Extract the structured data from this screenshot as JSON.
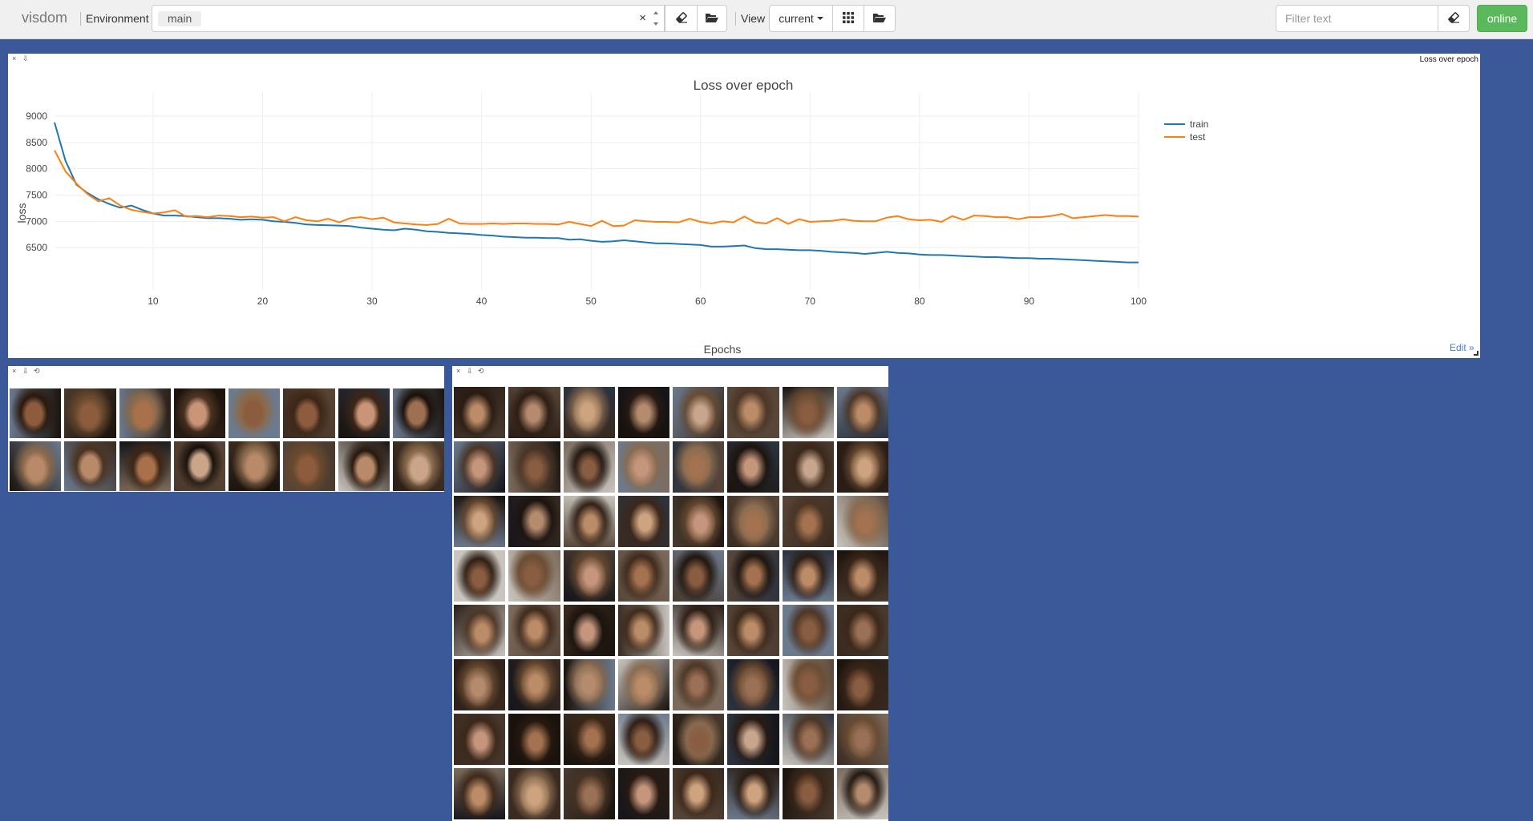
{
  "navbar": {
    "brand": "visdom",
    "environment_label": "Environment",
    "environment_chip": "main",
    "environment_clear": "×",
    "view_label": "View",
    "view_select": "current",
    "filter_placeholder": "Filter text",
    "status_button": "online"
  },
  "colors": {
    "background": "#3b5998",
    "train": "#1f77b4",
    "test": "#ff7f0e",
    "online": "#5cb85c",
    "edit_link": "#447adb"
  },
  "icons": {
    "env_eraser": "eraser-icon",
    "env_folder": "folder-open-icon",
    "view_grid": "grid-icon",
    "view_folder": "folder-open-icon",
    "filter_eraser": "eraser-icon",
    "pane_close": "×",
    "pane_download": "⇩",
    "pane_reset": "⟲"
  },
  "loss_pane": {
    "title": "Loss over epoch",
    "edit_link": "Edit »"
  },
  "chart_data": {
    "type": "line",
    "title": "Loss over epoch",
    "xlabel": "Epochs",
    "ylabel": "loss",
    "xlim": [
      1,
      100
    ],
    "ylim": [
      6000,
      9000
    ],
    "x_ticks": [
      10,
      20,
      30,
      40,
      50,
      60,
      70,
      80,
      90,
      100
    ],
    "y_ticks": [
      6500,
      7000,
      7500,
      8000,
      8500,
      9000
    ],
    "grid": true,
    "legend_position": "top-right",
    "x": [
      1,
      2,
      3,
      4,
      5,
      6,
      7,
      8,
      9,
      10,
      11,
      12,
      13,
      14,
      15,
      16,
      17,
      18,
      19,
      20,
      21,
      22,
      23,
      24,
      25,
      26,
      27,
      28,
      29,
      30,
      31,
      32,
      33,
      34,
      35,
      36,
      37,
      38,
      39,
      40,
      41,
      42,
      43,
      44,
      45,
      46,
      47,
      48,
      49,
      50,
      51,
      52,
      53,
      54,
      55,
      56,
      57,
      58,
      59,
      60,
      61,
      62,
      63,
      64,
      65,
      66,
      67,
      68,
      69,
      70,
      71,
      72,
      73,
      74,
      75,
      76,
      77,
      78,
      79,
      80,
      81,
      82,
      83,
      84,
      85,
      86,
      87,
      88,
      89,
      90,
      91,
      92,
      93,
      94,
      95,
      96,
      97,
      98,
      99,
      100
    ],
    "series": [
      {
        "name": "train",
        "values": [
          8880,
          8150,
          7700,
          7540,
          7420,
          7330,
          7260,
          7300,
          7220,
          7150,
          7110,
          7110,
          7100,
          7080,
          7060,
          7060,
          7050,
          7030,
          7040,
          7030,
          7000,
          6990,
          6970,
          6940,
          6930,
          6925,
          6920,
          6910,
          6880,
          6860,
          6840,
          6830,
          6860,
          6840,
          6810,
          6800,
          6780,
          6770,
          6760,
          6740,
          6730,
          6710,
          6700,
          6690,
          6690,
          6680,
          6680,
          6650,
          6660,
          6630,
          6610,
          6620,
          6640,
          6620,
          6600,
          6580,
          6580,
          6570,
          6560,
          6550,
          6520,
          6520,
          6530,
          6540,
          6490,
          6470,
          6470,
          6460,
          6450,
          6450,
          6440,
          6420,
          6410,
          6400,
          6380,
          6400,
          6420,
          6400,
          6390,
          6370,
          6360,
          6360,
          6350,
          6340,
          6330,
          6320,
          6320,
          6310,
          6300,
          6300,
          6290,
          6290,
          6280,
          6270,
          6260,
          6250,
          6240,
          6230,
          6220,
          6220
        ]
      },
      {
        "name": "test",
        "values": [
          8350,
          7950,
          7720,
          7520,
          7380,
          7440,
          7300,
          7220,
          7180,
          7150,
          7170,
          7210,
          7090,
          7100,
          7080,
          7110,
          7100,
          7080,
          7090,
          7070,
          7080,
          7000,
          7080,
          7020,
          7000,
          7050,
          6980,
          7060,
          7080,
          7040,
          7070,
          6980,
          6960,
          6940,
          6930,
          6950,
          7050,
          6960,
          6950,
          6950,
          6960,
          6950,
          6960,
          6960,
          6950,
          6950,
          6940,
          6990,
          6950,
          6910,
          7010,
          6910,
          6920,
          7020,
          7000,
          6990,
          6990,
          6980,
          7050,
          6990,
          6960,
          7000,
          6980,
          7090,
          6980,
          6960,
          7060,
          6950,
          7040,
          6990,
          7000,
          7010,
          7040,
          7010,
          7000,
          7000,
          7070,
          7100,
          7040,
          7020,
          7030,
          6990,
          7100,
          7030,
          7110,
          7100,
          7080,
          7080,
          7040,
          7080,
          7080,
          7100,
          7140,
          7060,
          7080,
          7100,
          7120,
          7100,
          7100,
          7090
        ]
      }
    ]
  },
  "grid_small": {
    "rows": 2,
    "cols": 8
  },
  "grid_large": {
    "rows": 8,
    "cols": 8
  }
}
